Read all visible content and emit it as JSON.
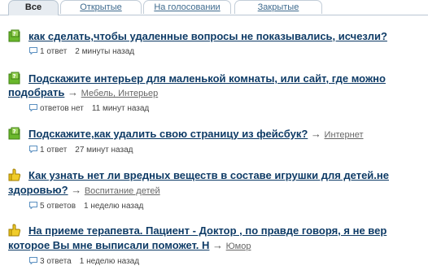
{
  "tabs": [
    {
      "label": "Все",
      "active": true
    },
    {
      "label": "Открытые",
      "active": false
    },
    {
      "label": "На голосовании",
      "active": false
    },
    {
      "label": "Закрытые",
      "active": false
    }
  ],
  "questions": [
    {
      "icon": "question-open-green-icon",
      "title": "как сделать,чтобы удаленные вопросы не показывались, исчезли?",
      "category": "",
      "answers": "1 ответ",
      "time": "2 минуты назад"
    },
    {
      "icon": "question-open-green-icon",
      "title_line1": "Подскажите интерьер для маленькой комнаты, или сайт, где можно",
      "title_line2": "подобрать",
      "arrow": "→",
      "category": "Мебель, Интерьер",
      "answers": "ответов нет",
      "time": "11 минут назад"
    },
    {
      "icon": "question-open-green-icon",
      "title": "Подскажите,как удалить свою страницу из фейсбук?",
      "arrow": "→",
      "category": "Интернет",
      "answers": "1 ответ",
      "time": "27 минут назад"
    },
    {
      "icon": "question-voting-yellow-icon",
      "title_line1": "Как узнать нет ли вредных веществ в составе игрушки для детей.не",
      "title_line2": "здоровью?",
      "arrow": "→",
      "category": "Воспитание детей",
      "answers": "5 ответов",
      "time": "1 неделю назад"
    },
    {
      "icon": "question-voting-yellow-icon",
      "title_line1": "На приеме терапевта. Пациент - Доктор , по правде говоря, я не вер",
      "title_line2": "которое Вы мне выписали поможет. Н",
      "arrow": "→",
      "category": "Юмор",
      "answers": "3 ответа",
      "time": "1 неделю назад"
    }
  ],
  "colors": {
    "link": "#0e3b66",
    "icon_green": "#6ab82c",
    "icon_yellow": "#e8c21a",
    "tab_active_bg": "#e7ecf1"
  }
}
